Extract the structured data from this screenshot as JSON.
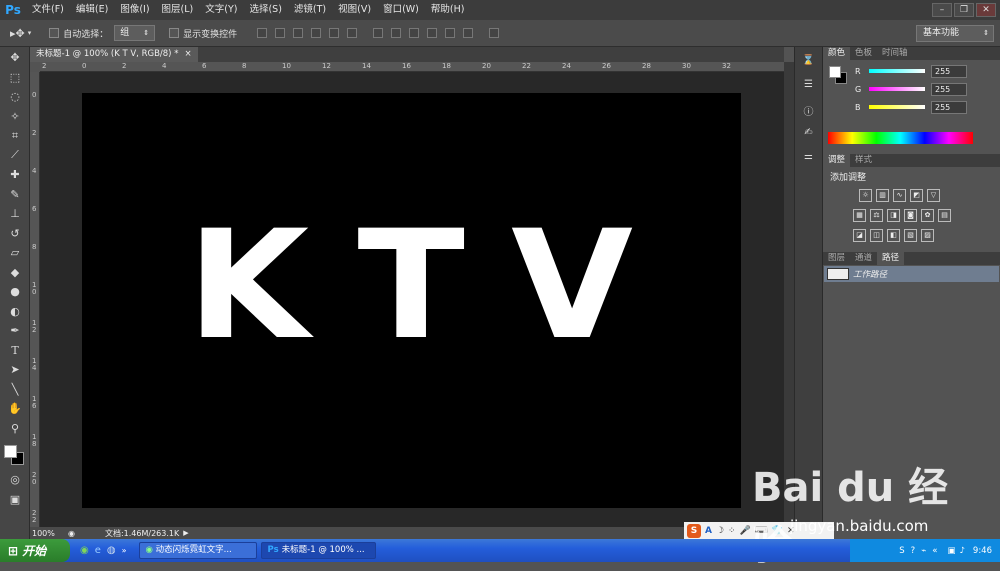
{
  "app": {
    "logo": "Ps"
  },
  "menu": [
    "文件(F)",
    "编辑(E)",
    "图像(I)",
    "图层(L)",
    "文字(Y)",
    "选择(S)",
    "滤镜(T)",
    "视图(V)",
    "窗口(W)",
    "帮助(H)"
  ],
  "options": {
    "auto_select_label": "自动选择：",
    "auto_select_value": "组",
    "show_transform_label": "显示变换控件",
    "workspace": "基本功能"
  },
  "document": {
    "tab_title": "未标题-1 @ 100% (K  T  V, RGB/8) *",
    "letters": [
      "K",
      "T",
      "V"
    ],
    "background_color": "#000000",
    "text_color": "#ffffff"
  },
  "ruler": {
    "h": [
      "2",
      "0",
      "2",
      "4",
      "6",
      "8",
      "10",
      "12",
      "14",
      "16",
      "18",
      "20",
      "22",
      "24",
      "26",
      "28",
      "30",
      "32"
    ],
    "v": [
      "0",
      "2",
      "4",
      "6",
      "8",
      "1\n0",
      "1\n2",
      "1\n4",
      "1\n6",
      "1\n8",
      "2\n0",
      "2\n2"
    ]
  },
  "status": {
    "zoom": "100%",
    "doc_info": "文档:1.46M/263.1K"
  },
  "color_panel": {
    "tabs": [
      "颜色",
      "色板",
      "时间轴"
    ],
    "channels": [
      {
        "label": "R",
        "value": "255"
      },
      {
        "label": "G",
        "value": "255"
      },
      {
        "label": "B",
        "value": "255"
      }
    ]
  },
  "adjust_panel": {
    "tabs": [
      "调整",
      "样式"
    ],
    "title": "添加调整"
  },
  "layers_panel": {
    "tabs": [
      "图层",
      "通道",
      "路径"
    ],
    "path_name": "工作路径"
  },
  "taskbar": {
    "start": "开始",
    "tasks": [
      "动态闪烁霓虹文字...",
      "未标题-1 @ 100% ..."
    ],
    "clock": "9:46"
  },
  "watermark": {
    "brand": "Bai  du 经验",
    "url": "jingyan.baidu.com"
  }
}
